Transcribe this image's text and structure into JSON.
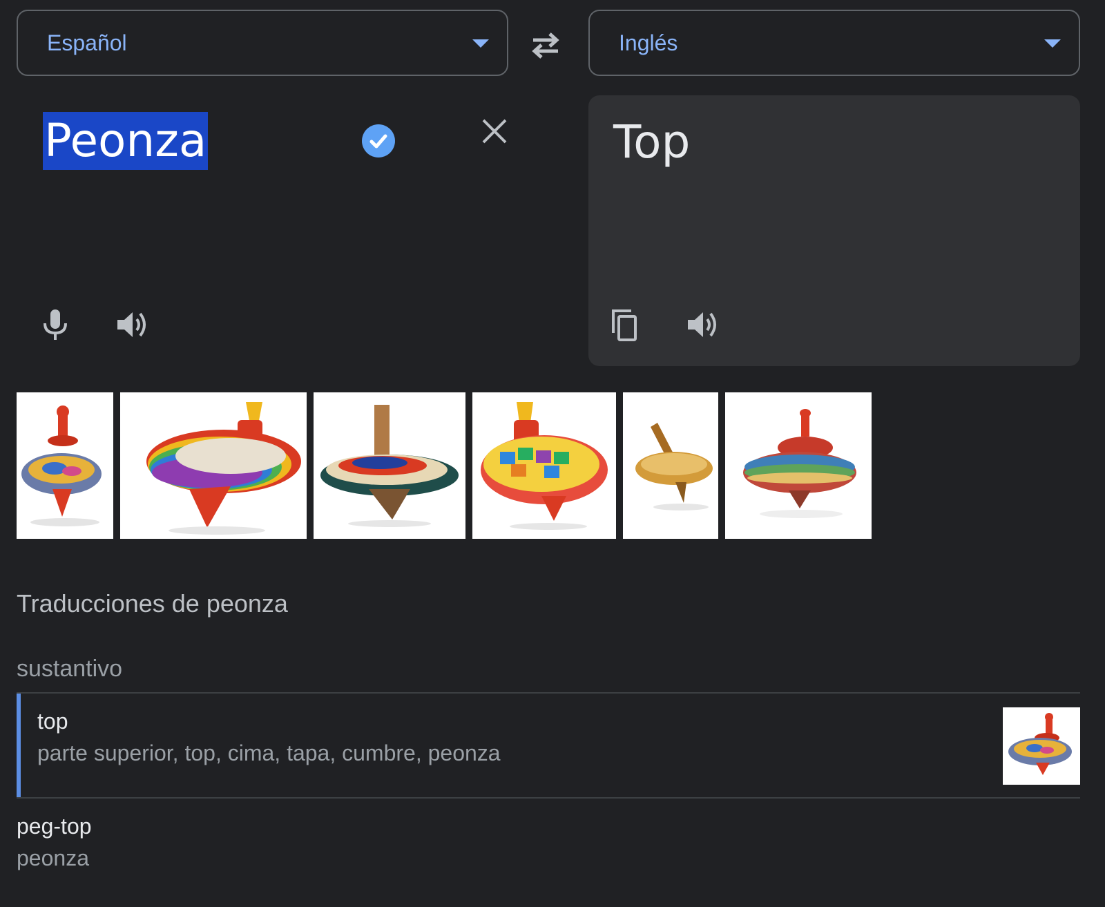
{
  "source_language": {
    "label": "Español"
  },
  "target_language": {
    "label": "Inglés"
  },
  "swap": {
    "icon": "swap-icon"
  },
  "source": {
    "text": "Peonza"
  },
  "target": {
    "text": "Top"
  },
  "colors": {
    "background": "#202124",
    "accent": "#8ab4f8",
    "selection": "#1a47c7",
    "panel": "#303134"
  },
  "section_title": "Traducciones de peonza",
  "part_of_speech": "sustantivo",
  "entries": [
    {
      "word": "top",
      "synonyms": "parte superior, top, cima, tapa, cumbre, peonza"
    },
    {
      "word": "peg-top",
      "synonyms": "peonza"
    }
  ]
}
